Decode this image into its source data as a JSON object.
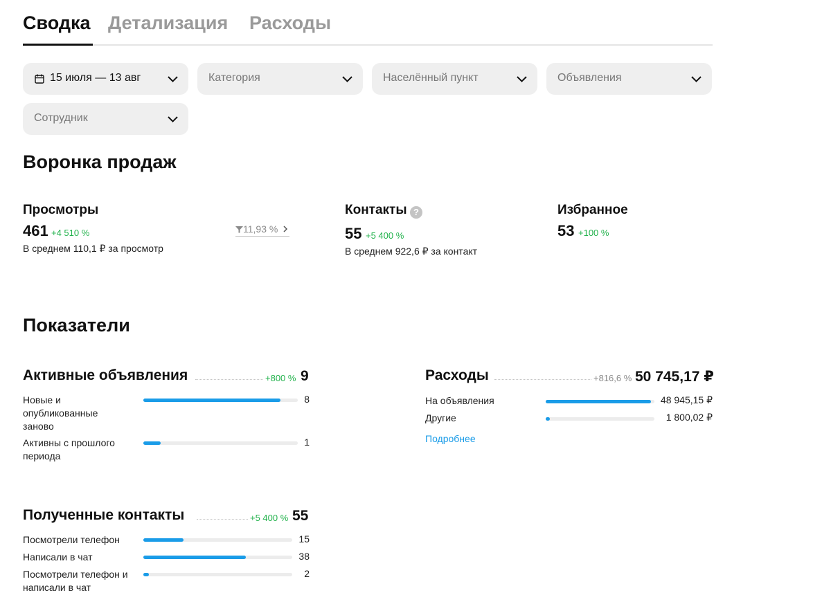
{
  "tabs": [
    {
      "label": "Сводка",
      "active": true
    },
    {
      "label": "Детализация",
      "active": false
    },
    {
      "label": "Расходы",
      "active": false
    }
  ],
  "filters": {
    "date": "15 июля — 13 авг",
    "category": "Категория",
    "city": "Населённый пункт",
    "ads": "Объявления",
    "employee": "Сотрудник"
  },
  "funnel": {
    "title": "Воронка продаж",
    "views": {
      "title": "Просмотры",
      "value": "461",
      "delta": "+4 510 %",
      "avg": "В среднем 110,1 ₽ за просмотр",
      "conversion": "11,93 %"
    },
    "contacts": {
      "title": "Контакты",
      "value": "55",
      "delta": "+5 400 %",
      "avg": "В среднем 922,6 ₽ за контакт",
      "help": "?"
    },
    "favorites": {
      "title": "Избранное",
      "value": "53",
      "delta": "+100 %"
    }
  },
  "indicators": {
    "title": "Показатели",
    "active_ads": {
      "title": "Активные объявления",
      "delta": "+800 %",
      "value": "9",
      "rows": [
        {
          "label": "Новые и опубликованные заново",
          "value": "8",
          "fraction": 0.89
        },
        {
          "label": "Активны с прошлого периода",
          "value": "1",
          "fraction": 0.11
        }
      ]
    },
    "expenses": {
      "title": "Расходы",
      "delta": "+816,6 %",
      "value": "50 745,17 ₽",
      "rows": [
        {
          "label": "На объявления",
          "value": "48 945,15 ₽",
          "fraction": 0.965
        },
        {
          "label": "Другие",
          "value": "1 800,02 ₽",
          "fraction": 0.035
        }
      ],
      "more": "Подробнее"
    },
    "contacts_received": {
      "title": "Полученные контакты",
      "delta": "+5 400 %",
      "value": "55",
      "rows": [
        {
          "label": "Посмотрели телефон",
          "value": "15",
          "fraction": 0.27
        },
        {
          "label": "Написали в чат",
          "value": "38",
          "fraction": 0.69
        },
        {
          "label": "Посмотрели телефон и написали в чат",
          "value": "2",
          "fraction": 0.036
        }
      ]
    }
  },
  "colors": {
    "accent": "#1a9ce8",
    "positive": "#22b24c",
    "muted": "#9a9a9a",
    "filter_bg": "#efefef"
  },
  "icons": {
    "calendar": "calendar-icon",
    "chevron": "chevron-down-icon",
    "funnel": "funnel-icon",
    "help": "help-circle-icon"
  }
}
